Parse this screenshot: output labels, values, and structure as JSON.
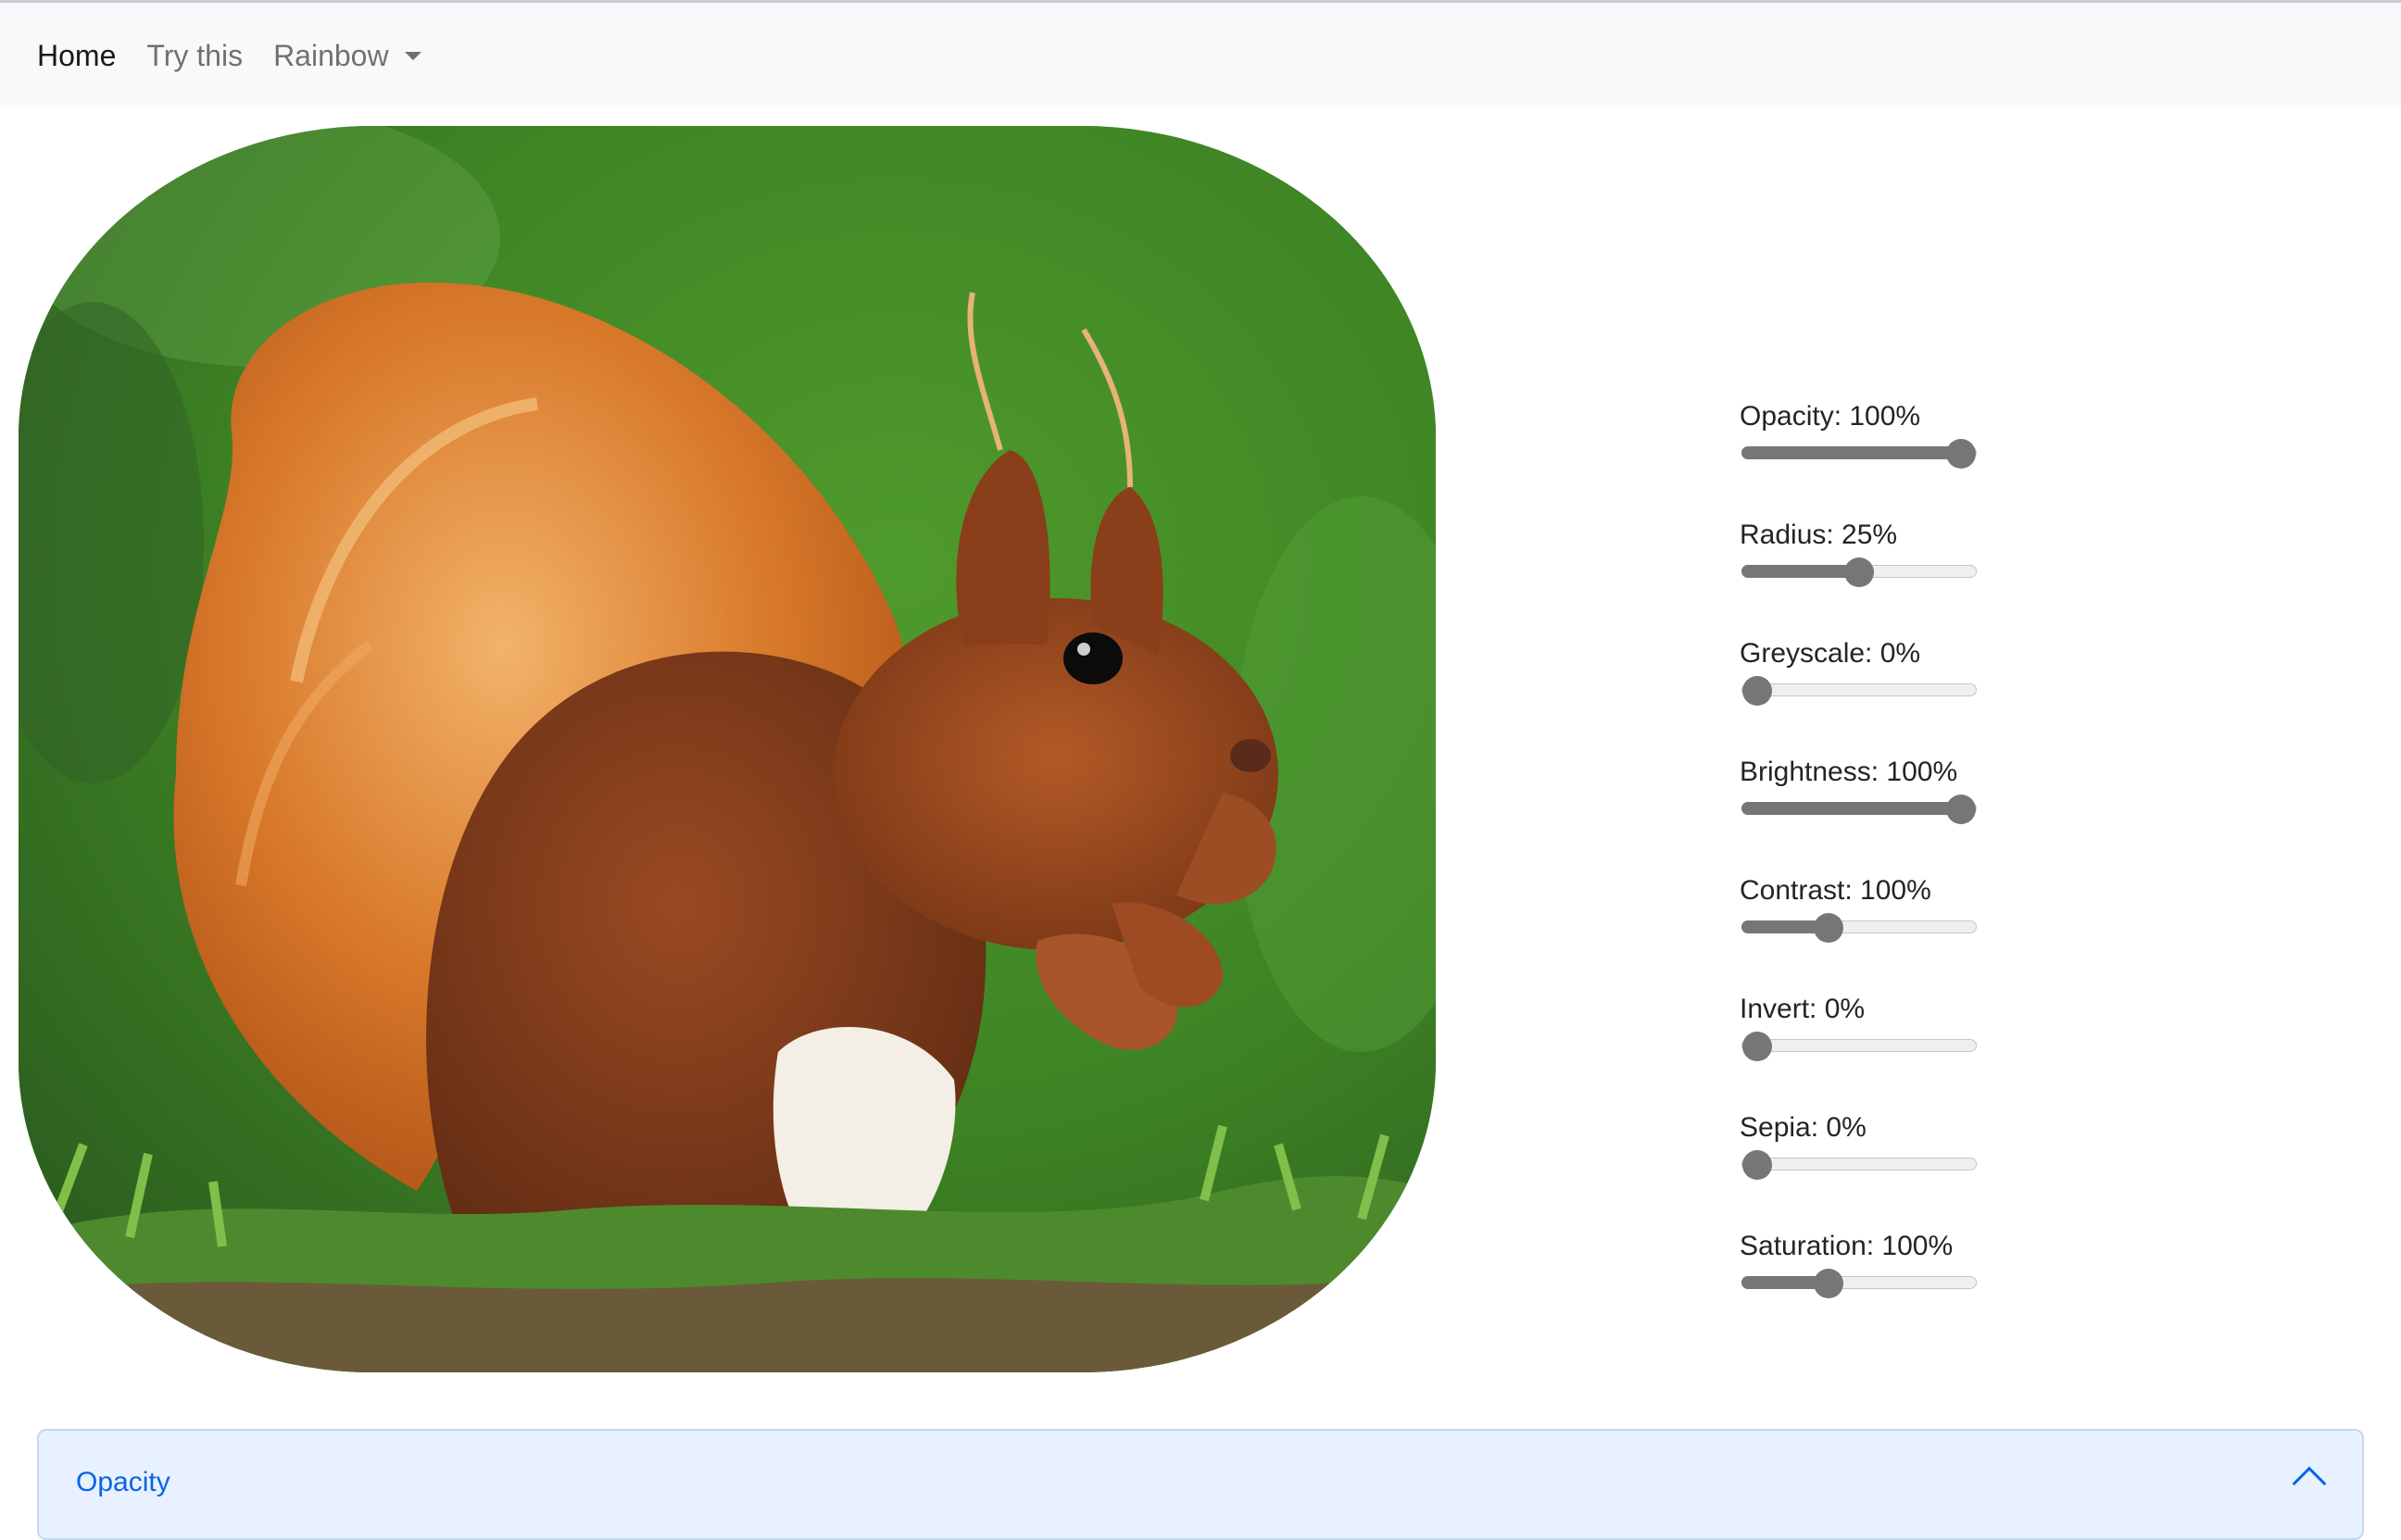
{
  "navbar": {
    "items": [
      {
        "label": "Home",
        "active": true
      },
      {
        "label": "Try this",
        "active": false
      },
      {
        "label": "Rainbow",
        "active": false,
        "dropdown": true
      }
    ]
  },
  "photo": {
    "subject": "red squirrel eating a nut on green grass",
    "border_radius_percent": 25
  },
  "filters": [
    {
      "label": "Opacity: 100%",
      "value": 1.0
    },
    {
      "label": "Radius: 25%",
      "value": 0.5
    },
    {
      "label": "Greyscale: 0%",
      "value": 0.0
    },
    {
      "label": "Brightness: 100%",
      "value": 1.0
    },
    {
      "label": "Contrast: 100%",
      "value": 0.35
    },
    {
      "label": "Invert: 0%",
      "value": 0.0
    },
    {
      "label": "Sepia: 0%",
      "value": 0.0
    },
    {
      "label": "Saturation: 100%",
      "value": 0.35
    }
  ],
  "accordion": {
    "title": "Opacity",
    "expanded": true,
    "chevron_icon": "chevron-up-icon"
  },
  "colors": {
    "navbar_bg": "#f8f9fa",
    "slider": "#767676",
    "accordion_bg": "#e7f1ff",
    "accordion_text": "#0c63e4"
  }
}
